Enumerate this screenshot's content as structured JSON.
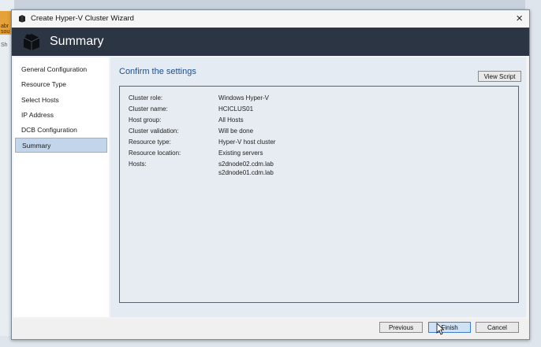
{
  "background": {
    "tile_text_1": "abr\nsou",
    "tile_text_2": "Sh"
  },
  "window": {
    "title": "Create Hyper-V Cluster Wizard",
    "close_label": "×"
  },
  "banner": {
    "title": "Summary"
  },
  "nav": {
    "items": [
      {
        "label": "General Configuration",
        "active": false
      },
      {
        "label": "Resource Type",
        "active": false
      },
      {
        "label": "Select Hosts",
        "active": false
      },
      {
        "label": "IP Address",
        "active": false
      },
      {
        "label": "DCB Configuration",
        "active": false
      },
      {
        "label": "Summary",
        "active": true
      }
    ]
  },
  "main": {
    "heading": "Confirm the settings",
    "view_script_label": "View Script",
    "settings": [
      {
        "label": "Cluster role:",
        "value": "Windows Hyper-V"
      },
      {
        "label": "Cluster name:",
        "value": "HCICLUS01"
      },
      {
        "label": "Host group:",
        "value": "All Hosts"
      },
      {
        "label": "Cluster validation:",
        "value": "Will be done"
      },
      {
        "label": "Resource type:",
        "value": "Hyper-V host cluster"
      },
      {
        "label": "Resource location:",
        "value": "Existing servers"
      },
      {
        "label": "Hosts:",
        "value": "s2dnode02.cdm.lab"
      }
    ],
    "hosts_second": "s2dnode01.cdm.lab"
  },
  "footer": {
    "previous_label": "Previous",
    "finish_label": "Finish",
    "cancel_label": "Cancel"
  },
  "colors": {
    "banner": "#2b3543",
    "accent": "#1f4e8c",
    "nav_active": "#c3d5ea",
    "content_bg": "#e4ebf2"
  }
}
